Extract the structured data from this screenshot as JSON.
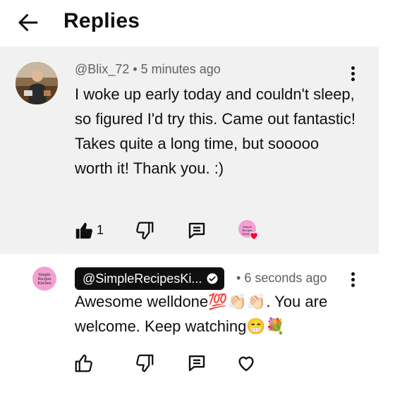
{
  "header": {
    "title": "Replies"
  },
  "parent_comment": {
    "author": "@Blix_72",
    "separator": "•",
    "time": "5 minutes ago",
    "text": "I woke up early today and couldn't sleep, so figured I'd try this. Came out fantastic!  Takes quite a long time, but sooooo worth it!  Thank you. :)",
    "like_count": "1",
    "creator_avatar_text": "Simple Recipes Kitchen"
  },
  "reply": {
    "author": "@SimpleRecipesKi...",
    "separator": "•",
    "time": "6 seconds ago",
    "text": "Awesome welldone💯👏🏻👏🏻. You are welcome. Keep watching😁💐",
    "avatar_text": "Simple Recipes Kitchen"
  },
  "icons": {
    "back": "arrow-left-icon",
    "menu": "more-vert-icon",
    "like": "thumbs-up-icon",
    "dislike": "thumbs-down-icon",
    "reply": "comment-icon",
    "heart": "heart-icon",
    "verified": "check-circle-icon"
  },
  "colors": {
    "parent_bg": "#f1f1f1",
    "heart_red": "#ff0033",
    "avatar_pink": "#f3a0d3"
  }
}
